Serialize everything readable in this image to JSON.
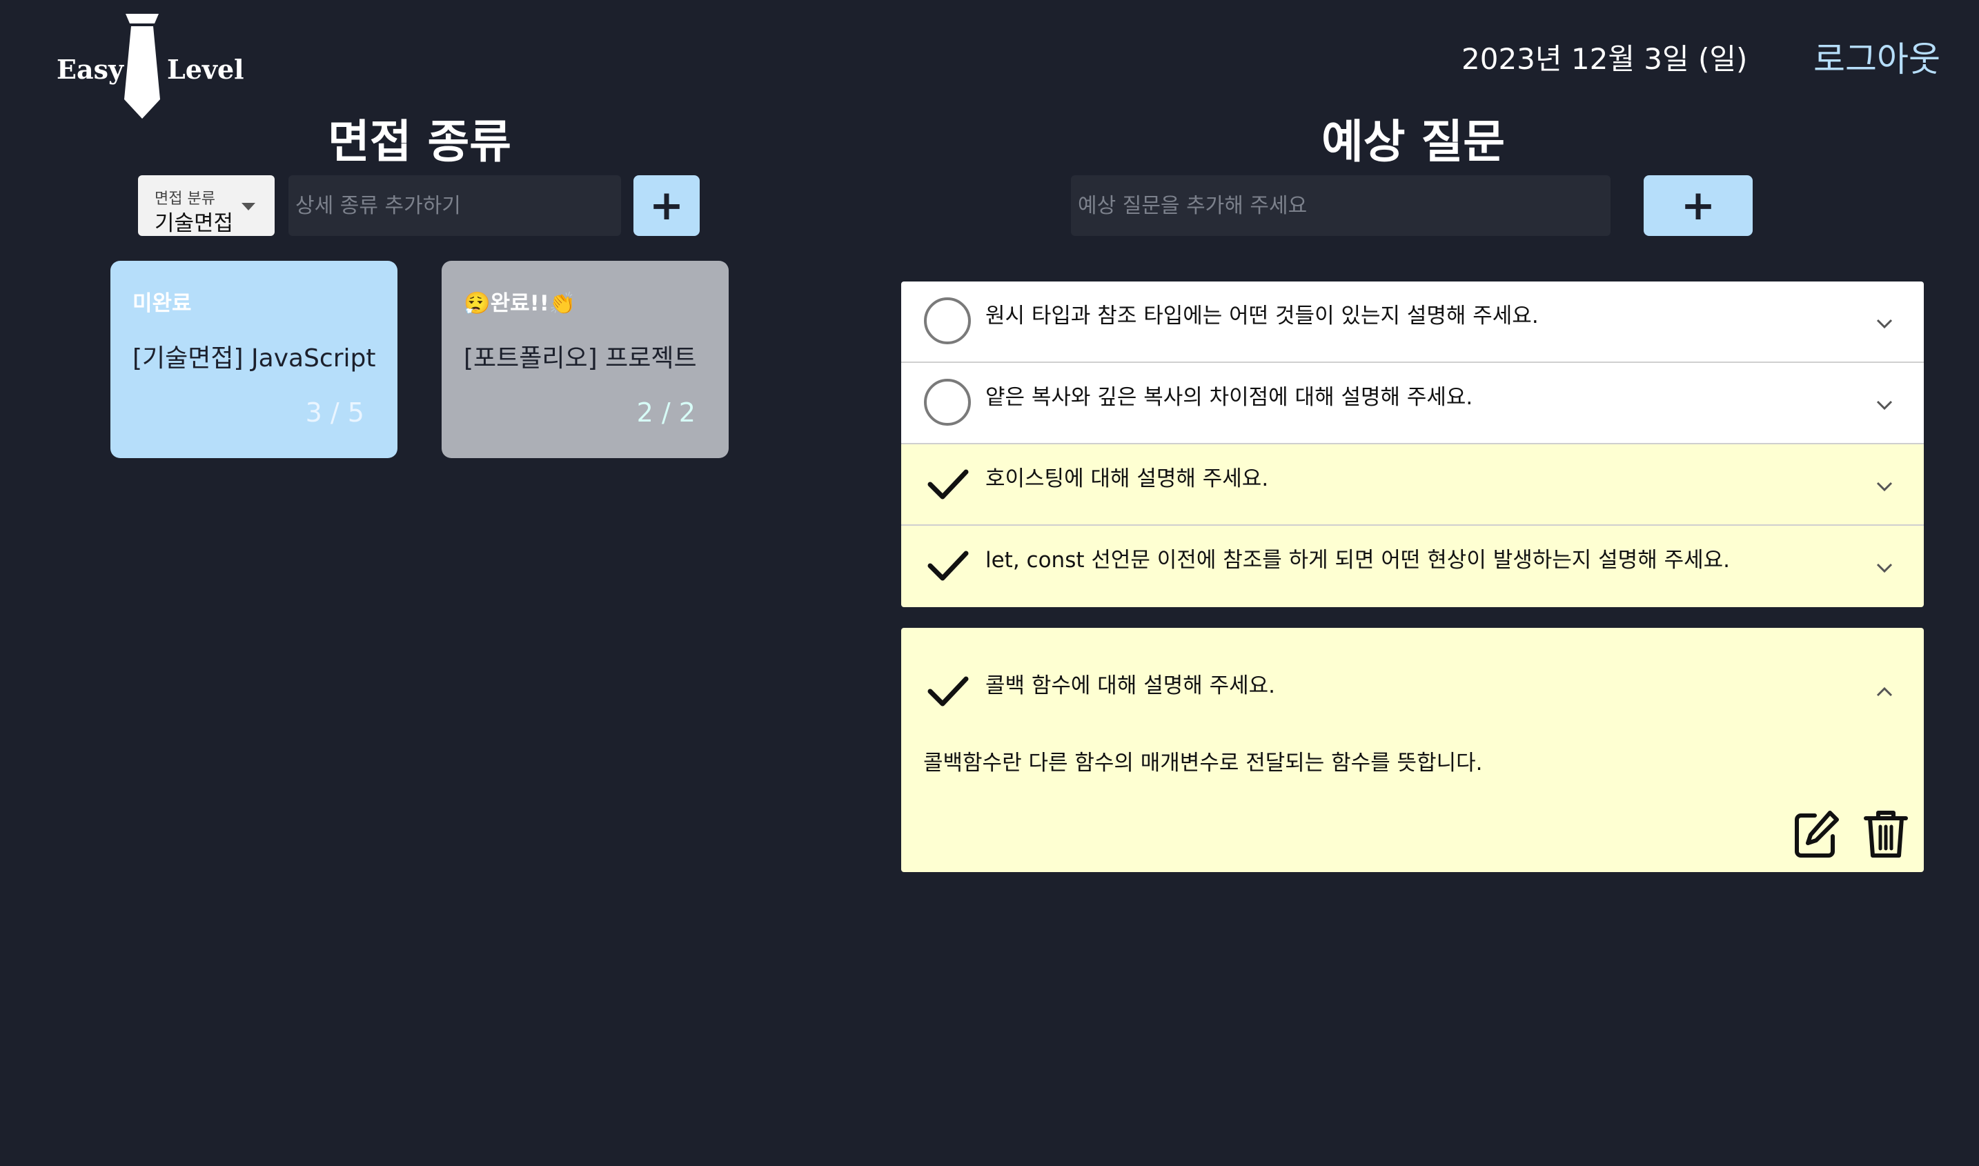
{
  "header": {
    "logo_left": "Easy",
    "logo_right": "Level",
    "date": "2023년 12월 3일 (일)",
    "logout_label": "로그아웃"
  },
  "interview_types": {
    "title": "면접 종류",
    "category_select": {
      "caption": "면접 분류",
      "value": "기술면접"
    },
    "detail_input": {
      "placeholder": "상세 종류 추가하기",
      "value": ""
    },
    "add_button_label": "+",
    "cards": [
      {
        "status": "미완료",
        "title": "[기술면접] JavaScript",
        "count": "3 / 5",
        "state": "incomplete"
      },
      {
        "status": "😮‍💨완료!!👏",
        "title": "[포트폴리오] 프로젝트",
        "count": "2 / 2",
        "state": "complete"
      }
    ]
  },
  "questions": {
    "title": "예상 질문",
    "question_input": {
      "placeholder": "예상 질문을 추가해 주세요",
      "value": ""
    },
    "add_button_label": "+",
    "items": [
      {
        "text": "원시 타입과 참조 타입에는 어떤 것들이 있는지 설명해 주세요.",
        "done": false
      },
      {
        "text": "얕은 복사와 깊은 복사의 차이점에 대해 설명해 주세요.",
        "done": false
      },
      {
        "text": "호이스팅에 대해 설명해 주세요.",
        "done": true
      },
      {
        "text": "let, const 선언문 이전에 참조를 하게 되면 어떤 현상이 발생하는지 설명해 주세요.",
        "done": true
      }
    ],
    "expanded": {
      "text": "콜백 함수에 대해 설명해 주세요.",
      "done": true,
      "answer": "콜백함수란 다른 함수의 매개변수로 전달되는 함수를 뜻합니다."
    }
  },
  "colors": {
    "background": "#1c202c",
    "accent": "#b6defa",
    "done_row": "#feffd2",
    "complete_card": "#acafb6"
  }
}
